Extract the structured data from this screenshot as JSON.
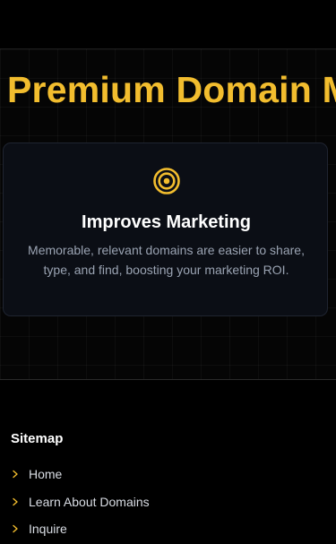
{
  "hero": {
    "title": "Premium Domain Marketplace"
  },
  "feature": {
    "icon": "target-icon",
    "title": "Improves Marketing",
    "description": "Memorable, relevant domains are easier to share, type, and find, boosting your marketing ROI."
  },
  "footer": {
    "sitemap_heading": "Sitemap",
    "links": [
      {
        "label": "Home",
        "icon": "chevron-right-icon"
      },
      {
        "label": "Learn About Domains",
        "icon": "chevron-right-icon"
      },
      {
        "label": "Inquire",
        "icon": "chevron-right-icon"
      }
    ]
  },
  "colors": {
    "accent": "#f2bd2e",
    "background": "#000000",
    "card_background": "#0b0e15",
    "muted_text": "#9aa3b2"
  }
}
